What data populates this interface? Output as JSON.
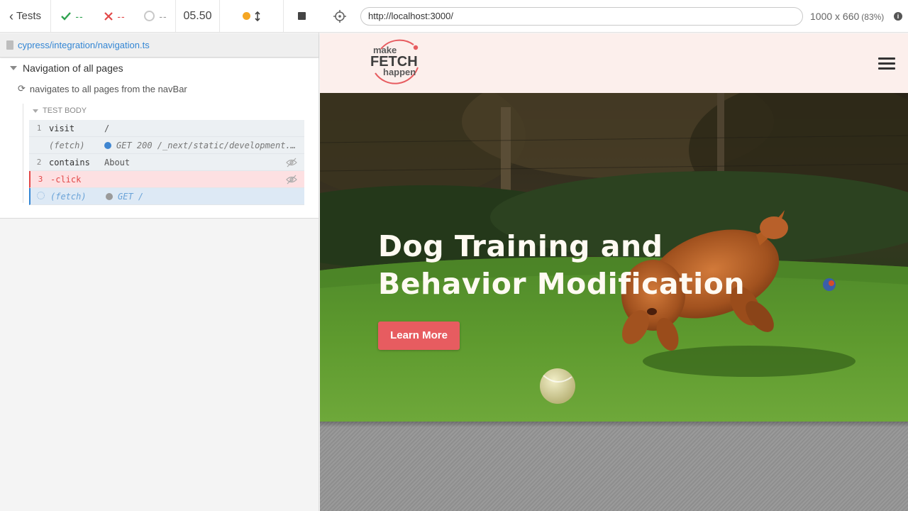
{
  "reporter": {
    "tests_label": "Tests",
    "passed": "--",
    "failed": "--",
    "pending": "--",
    "duration": "05.50",
    "spec_path": "cypress/integration/navigation.ts",
    "suite_title": "Navigation of all pages",
    "test_title": "navigates to all pages from the navBar",
    "hook_title": "TEST BODY",
    "commands": [
      {
        "num": "1",
        "name": "visit",
        "message": "/"
      },
      {
        "num": "",
        "name": "(fetch)",
        "message": "GET 200 /_next/static/development..."
      },
      {
        "num": "2",
        "name": "contains",
        "message": "About"
      },
      {
        "num": "3",
        "name": "-click",
        "message": ""
      },
      {
        "num": "",
        "name": "(fetch)",
        "message": "GET /"
      }
    ]
  },
  "browser": {
    "url": "http://localhost:3000/",
    "viewport": "1000 x 660",
    "zoom": "(83%)"
  },
  "site": {
    "logo": {
      "line1": "make",
      "line2": "FETCH",
      "line3": "happen"
    },
    "hero_title_line1": "Dog Training and",
    "hero_title_line2": "Behavior Modification",
    "cta": "Learn More"
  },
  "colors": {
    "pass": "#2ea24f",
    "fail": "#e24848",
    "running": "#f5a623",
    "link": "#3386d4",
    "cta": "#e75c60",
    "site_header_bg": "#fcefec"
  }
}
